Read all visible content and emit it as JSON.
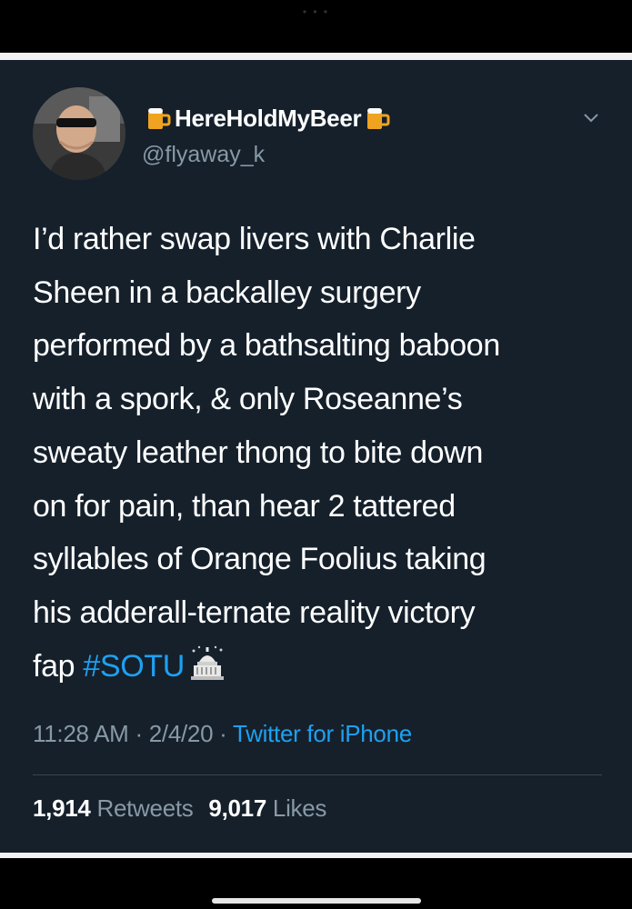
{
  "user": {
    "display_name": "HereHoldMyBeer",
    "handle": "@flyaway_k",
    "name_prefix_icon": "beer-mug-icon",
    "name_suffix_icon": "beer-mug-icon"
  },
  "tweet": {
    "lines": [
      "I’d rather swap livers with Charlie",
      "Sheen in a backalley surgery",
      "performed by a bathsalting baboon",
      "with a spork, & only Roseanne’s",
      "sweaty leather thong to bite down",
      "on for pain, than hear 2 tattered",
      "syllables of Orange Foolius taking",
      "his adderall-ternate reality victory"
    ],
    "last_line_text": "fap ",
    "hashtag": "#SOTU",
    "trailing_icon": "capitol-building-icon"
  },
  "meta": {
    "time": "11:28 AM",
    "separator": " · ",
    "date": "2/4/20",
    "source": "Twitter for iPhone"
  },
  "stats": {
    "retweets_count": "1,914",
    "retweets_label": " Retweets",
    "likes_count": "9,017",
    "likes_label": " Likes"
  },
  "colors": {
    "background": "#15202b",
    "text": "#ffffff",
    "secondary": "#8899a6",
    "link": "#1da1f2"
  }
}
